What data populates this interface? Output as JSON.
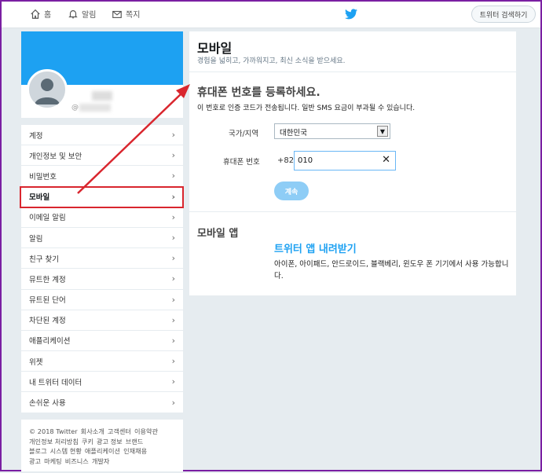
{
  "topbar": {
    "home_label": "홈",
    "notifications_label": "알림",
    "messages_label": "쪽지",
    "search_label": "트위터 검색하기"
  },
  "profile": {
    "handle_prefix": "@"
  },
  "sidebar": {
    "items": [
      {
        "label": "계정"
      },
      {
        "label": "개인정보 및 보안"
      },
      {
        "label": "비밀번호"
      },
      {
        "label": "모바일"
      },
      {
        "label": "이메일 알림"
      },
      {
        "label": "알림"
      },
      {
        "label": "친구 찾기"
      },
      {
        "label": "뮤트한 계정"
      },
      {
        "label": "뮤트된 단어"
      },
      {
        "label": "차단된 계정"
      },
      {
        "label": "애플리케이션"
      },
      {
        "label": "위젯"
      },
      {
        "label": "내 트위터 데이터"
      },
      {
        "label": "손쉬운 사용"
      }
    ]
  },
  "footer": {
    "links": [
      "© 2018 Twitter",
      "회사소개",
      "고객센터",
      "이용약관",
      "개인정보 처리방침",
      "쿠키",
      "광고 정보",
      "브랜드",
      "블로그",
      "시스템 현황",
      "애플리케이션",
      "인재채용",
      "광고",
      "마케팅",
      "비즈니스",
      "개발자"
    ]
  },
  "main": {
    "title": "모바일",
    "subtitle": "경험을 넓히고, 가까워지고, 최신 소식을 받으세요.",
    "register_title": "휴대폰 번호를 등록하세요.",
    "register_desc": "이 번호로 인증 코드가 전송됩니다. 일반 SMS 요금이 부과될 수 있습니다.",
    "country_label": "국가/지역",
    "country_value": "대한민국",
    "phone_label": "휴대폰 번호",
    "phone_prefix": "+82",
    "phone_value": "010",
    "continue_label": "계속",
    "app_section_title": "모바일 앱",
    "app_link": "트위터 앱 내려받기",
    "app_desc": "아이폰, 아이패드, 안드로이드, 블랙베리, 윈도우 폰 기기에서 사용 가능합니다."
  },
  "colors": {
    "brand": "#1da1f2",
    "annotation": "#d9262e"
  }
}
